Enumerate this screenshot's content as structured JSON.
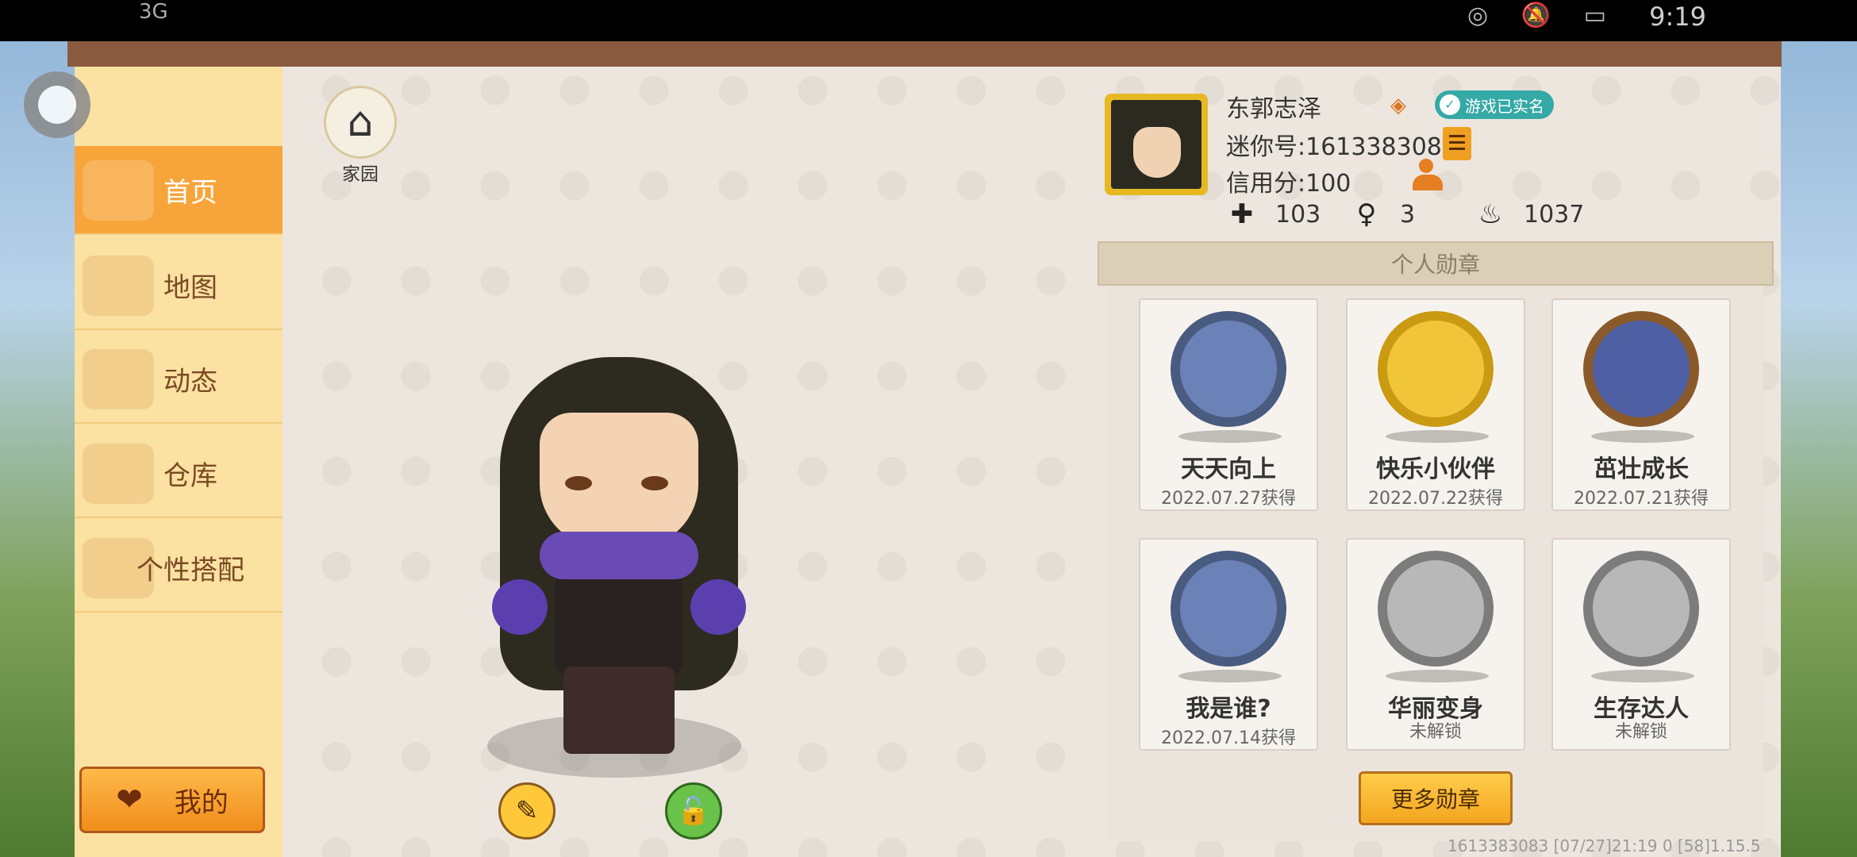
{
  "status_bar": {
    "signal": "3G",
    "time": "9:19"
  },
  "home": {
    "label": "家园"
  },
  "nav": {
    "items": [
      {
        "label": "首页",
        "active": true
      },
      {
        "label": "地图"
      },
      {
        "label": "动态"
      },
      {
        "label": "仓库"
      },
      {
        "label": "个性搭配"
      }
    ],
    "mine_label": "我的"
  },
  "profile": {
    "name": "东郭志泽",
    "verified": "游戏已实名",
    "mini_id": "迷你号:1613383083",
    "credit": "信用分:100",
    "stats": {
      "add": "103",
      "fans": "3",
      "fire": "1037"
    }
  },
  "medals": {
    "header": "个人勋章",
    "items": [
      {
        "name": "天天向上",
        "status": "2022.07.27获得"
      },
      {
        "name": "快乐小伙伴",
        "status": "2022.07.22获得"
      },
      {
        "name": "茁壮成长",
        "status": "2022.07.21获得"
      },
      {
        "name": "我是谁?",
        "status": "2022.07.14获得"
      },
      {
        "name": "华丽变身",
        "status": "未解锁"
      },
      {
        "name": "生存达人",
        "status": "未解锁"
      }
    ],
    "more_label": "更多勋章"
  },
  "footer": "1613383083   [07/27]21:19 0  [58]1.15.5"
}
